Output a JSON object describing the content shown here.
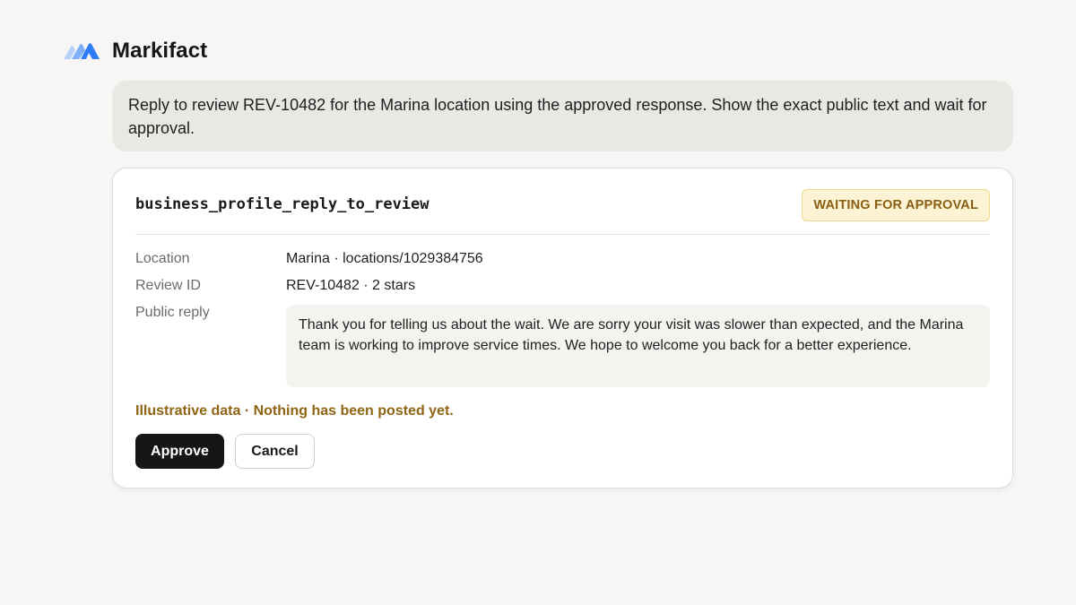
{
  "app": {
    "name": "Markifact",
    "logo_icon": "markifact-logo-icon",
    "accent_color": "#3b82f6"
  },
  "user_message": {
    "text": "Reply to review REV-10482 for the Marina location using the approved response. Show the exact public text and wait for approval."
  },
  "tool_card": {
    "tool_name": "business_profile_reply_to_review",
    "status": {
      "label": "WAITING FOR APPROVAL",
      "color": "#8a5f12",
      "background": "#fcf2d4"
    },
    "fields": {
      "location": {
        "label": "Location",
        "value": "Marina · locations/1029384756"
      },
      "review_id": {
        "label": "Review ID",
        "value": "REV-10482 · 2 stars"
      },
      "public_reply": {
        "label": "Public reply",
        "value": "Thank you for telling us about the wait. We are sorry your visit was slower than expected, and the Marina team is working to improve service times. We hope to welcome you back for a better experience."
      }
    },
    "notice": "Illustrative data · Nothing has been posted yet.",
    "actions": {
      "approve_label": "Approve",
      "cancel_label": "Cancel"
    }
  }
}
